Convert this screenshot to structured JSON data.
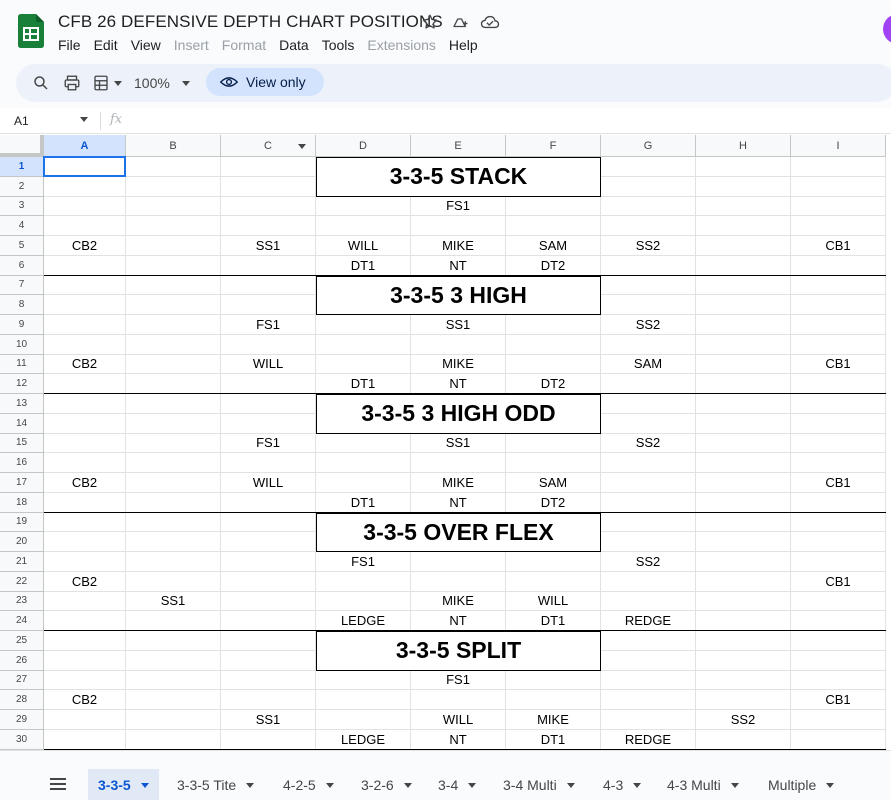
{
  "app": {
    "title": "CFB 26 DEFENSIVE DEPTH CHART POSITIONS",
    "menu": [
      "File",
      "Edit",
      "View",
      "Insert",
      "Format",
      "Data",
      "Tools",
      "Extensions",
      "Help"
    ],
    "menu_disabled": [
      "Insert",
      "Format",
      "Extensions"
    ]
  },
  "toolbar": {
    "zoom": "100%",
    "view_only_label": "View only"
  },
  "formula_bar": {
    "name_box": "A1",
    "fx_label": "fx"
  },
  "grid": {
    "columns": [
      "A",
      "B",
      "C",
      "D",
      "E",
      "F",
      "G",
      "H",
      "I"
    ],
    "selected_column": "A",
    "selected_row": 1,
    "rows": [
      "1",
      "2",
      "3",
      "4",
      "5",
      "6",
      "7",
      "8",
      "9",
      "10",
      "11",
      "12",
      "13",
      "14",
      "15",
      "16",
      "17",
      "18",
      "19",
      "20",
      "21",
      "22",
      "23",
      "24",
      "25",
      "26",
      "27",
      "28",
      "29",
      "30"
    ],
    "titles": [
      {
        "row": 1,
        "text": "3-3-5 STACK"
      },
      {
        "row": 7,
        "text": "3-3-5 3 HIGH"
      },
      {
        "row": 13,
        "text": "3-3-5 3 HIGH ODD"
      },
      {
        "row": 19,
        "text": "3-3-5 OVER FLEX"
      },
      {
        "row": 25,
        "text": "3-3-5 SPLIT"
      }
    ],
    "cells": [
      {
        "row": 3,
        "col": "E",
        "text": "FS1"
      },
      {
        "row": 5,
        "col": "A",
        "text": "CB2"
      },
      {
        "row": 5,
        "col": "C",
        "text": "SS1"
      },
      {
        "row": 5,
        "col": "D",
        "text": "WILL"
      },
      {
        "row": 5,
        "col": "E",
        "text": "MIKE"
      },
      {
        "row": 5,
        "col": "F",
        "text": "SAM"
      },
      {
        "row": 5,
        "col": "G",
        "text": "SS2"
      },
      {
        "row": 5,
        "col": "I",
        "text": "CB1"
      },
      {
        "row": 6,
        "col": "D",
        "text": "DT1"
      },
      {
        "row": 6,
        "col": "E",
        "text": "NT"
      },
      {
        "row": 6,
        "col": "F",
        "text": "DT2"
      },
      {
        "row": 9,
        "col": "C",
        "text": "FS1"
      },
      {
        "row": 9,
        "col": "E",
        "text": "SS1"
      },
      {
        "row": 9,
        "col": "G",
        "text": "SS2"
      },
      {
        "row": 11,
        "col": "A",
        "text": "CB2"
      },
      {
        "row": 11,
        "col": "C",
        "text": "WILL"
      },
      {
        "row": 11,
        "col": "E",
        "text": "MIKE"
      },
      {
        "row": 11,
        "col": "G",
        "text": "SAM"
      },
      {
        "row": 11,
        "col": "I",
        "text": "CB1"
      },
      {
        "row": 12,
        "col": "D",
        "text": "DT1"
      },
      {
        "row": 12,
        "col": "E",
        "text": "NT"
      },
      {
        "row": 12,
        "col": "F",
        "text": "DT2"
      },
      {
        "row": 15,
        "col": "C",
        "text": "FS1"
      },
      {
        "row": 15,
        "col": "E",
        "text": "SS1"
      },
      {
        "row": 15,
        "col": "G",
        "text": "SS2"
      },
      {
        "row": 17,
        "col": "A",
        "text": "CB2"
      },
      {
        "row": 17,
        "col": "C",
        "text": "WILL"
      },
      {
        "row": 17,
        "col": "E",
        "text": "MIKE"
      },
      {
        "row": 17,
        "col": "F",
        "text": "SAM"
      },
      {
        "row": 17,
        "col": "I",
        "text": "CB1"
      },
      {
        "row": 18,
        "col": "D",
        "text": "DT1"
      },
      {
        "row": 18,
        "col": "E",
        "text": "NT"
      },
      {
        "row": 18,
        "col": "F",
        "text": "DT2"
      },
      {
        "row": 21,
        "col": "D",
        "text": "FS1"
      },
      {
        "row": 21,
        "col": "G",
        "text": "SS2"
      },
      {
        "row": 22,
        "col": "A",
        "text": "CB2"
      },
      {
        "row": 22,
        "col": "I",
        "text": "CB1"
      },
      {
        "row": 23,
        "col": "B",
        "text": "SS1"
      },
      {
        "row": 23,
        "col": "E",
        "text": "MIKE"
      },
      {
        "row": 23,
        "col": "F",
        "text": "WILL"
      },
      {
        "row": 24,
        "col": "D",
        "text": "LEDGE"
      },
      {
        "row": 24,
        "col": "E",
        "text": "NT"
      },
      {
        "row": 24,
        "col": "F",
        "text": "DT1"
      },
      {
        "row": 24,
        "col": "G",
        "text": "REDGE"
      },
      {
        "row": 27,
        "col": "E",
        "text": "FS1"
      },
      {
        "row": 28,
        "col": "A",
        "text": "CB2"
      },
      {
        "row": 28,
        "col": "I",
        "text": "CB1"
      },
      {
        "row": 29,
        "col": "C",
        "text": "SS1"
      },
      {
        "row": 29,
        "col": "E",
        "text": "WILL"
      },
      {
        "row": 29,
        "col": "F",
        "text": "MIKE"
      },
      {
        "row": 29,
        "col": "H",
        "text": "SS2"
      },
      {
        "row": 30,
        "col": "D",
        "text": "LEDGE"
      },
      {
        "row": 30,
        "col": "E",
        "text": "NT"
      },
      {
        "row": 30,
        "col": "F",
        "text": "DT1"
      },
      {
        "row": 30,
        "col": "G",
        "text": "REDGE"
      }
    ]
  },
  "sheets": {
    "active": "3-3-5",
    "tabs": [
      "3-3-5",
      "3-3-5 Tite",
      "4-2-5",
      "3-2-6",
      "3-4",
      "3-4 Multi",
      "4-3",
      "4-3 Multi",
      "Multiple"
    ]
  },
  "colors": {
    "accent": "#0b57d0",
    "view_only_bg": "#d3e3fd",
    "sheets_green": "#188038",
    "avatar": "#a142f4"
  },
  "icons": {
    "logo": "sheets-logo-icon",
    "star": "star-icon",
    "move": "move-to-drive-icon",
    "cloud": "cloud-status-icon",
    "search": "search-icon",
    "print": "print-icon",
    "format_paint": "format-icon",
    "eye": "eye-icon",
    "sheet_menu": "all-sheets-icon"
  }
}
